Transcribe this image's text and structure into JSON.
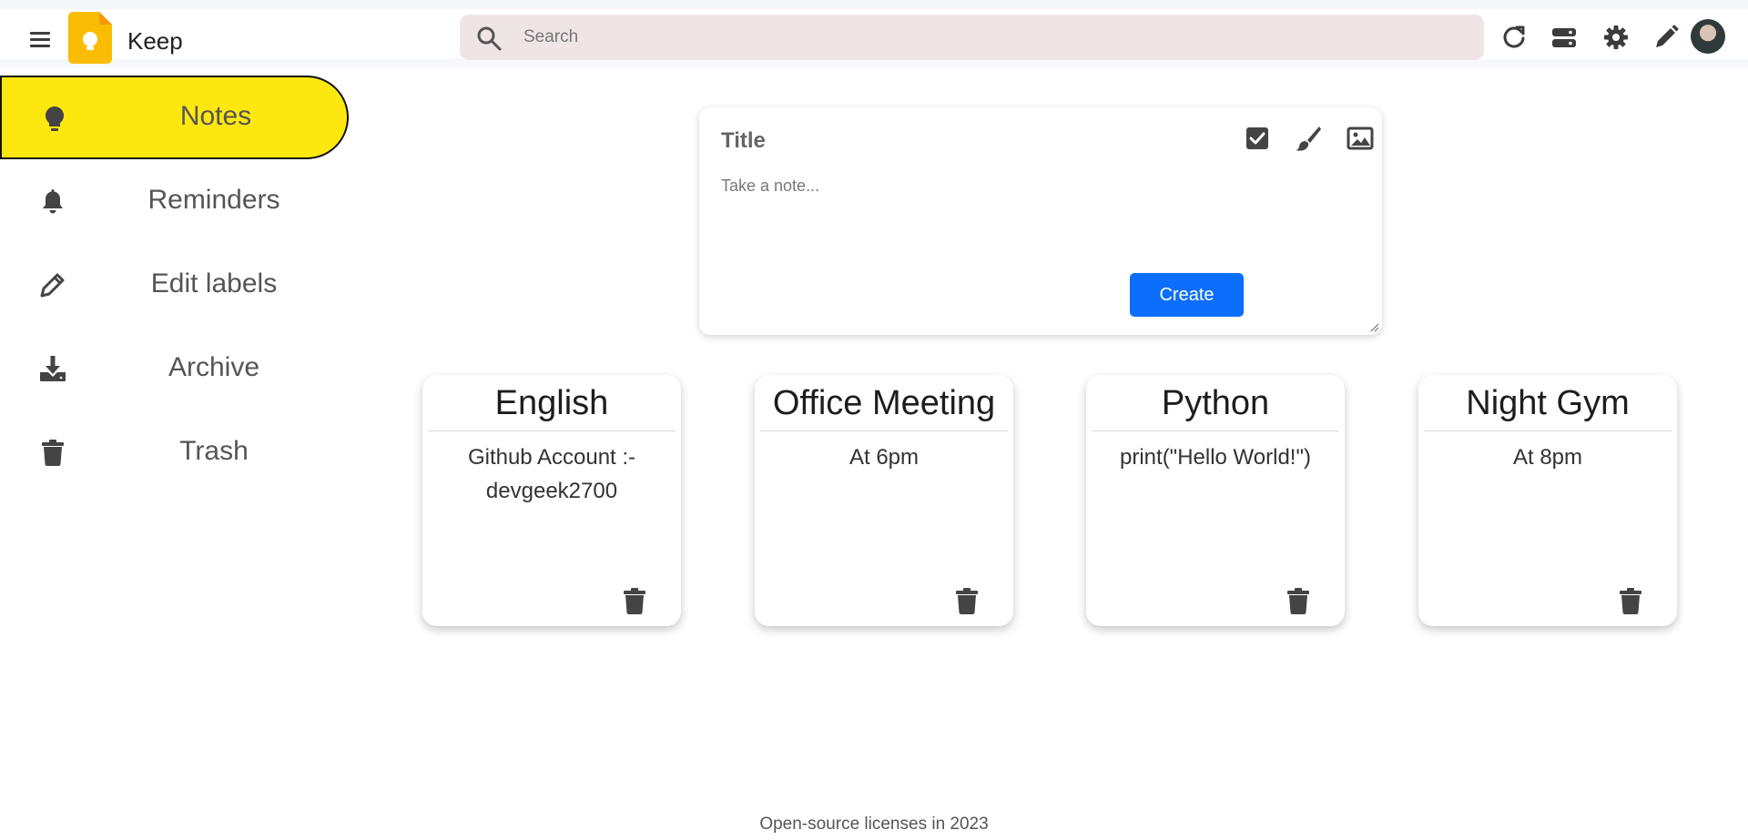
{
  "header": {
    "app_title": "Keep",
    "search_placeholder": "Search",
    "icons": [
      "menu-icon",
      "search-icon",
      "refresh-icon",
      "view-toggle-icon",
      "gear-icon",
      "pencil-icon"
    ]
  },
  "sidebar": {
    "items": [
      {
        "label": "Notes",
        "icon": "lightbulb-icon",
        "active": true
      },
      {
        "label": "Reminders",
        "icon": "bell-icon"
      },
      {
        "label": "Edit labels",
        "icon": "pencil-icon"
      },
      {
        "label": "Archive",
        "icon": "archive-download-icon"
      },
      {
        "label": "Trash",
        "icon": "trash-icon"
      }
    ]
  },
  "composer": {
    "title_placeholder": "Title",
    "note_placeholder": "Take a note...",
    "create_label": "Create",
    "icons": [
      "checkbox-icon",
      "brush-icon",
      "image-icon"
    ]
  },
  "notes": [
    {
      "title": "English",
      "body": "Github Account :- devgeek2700"
    },
    {
      "title": "Office Meeting",
      "body": "At 6pm"
    },
    {
      "title": "Python",
      "body": "print(\"Hello World!\")"
    },
    {
      "title": "Night Gym",
      "body": "At 8pm"
    }
  ],
  "footer": {
    "text": "Open-source licenses in 2023"
  },
  "colors": {
    "accent_yellow": "#fce80f",
    "create_blue": "#0d6efd",
    "search_bg": "#efe5e7",
    "logo_orange": "#fbbc04"
  }
}
